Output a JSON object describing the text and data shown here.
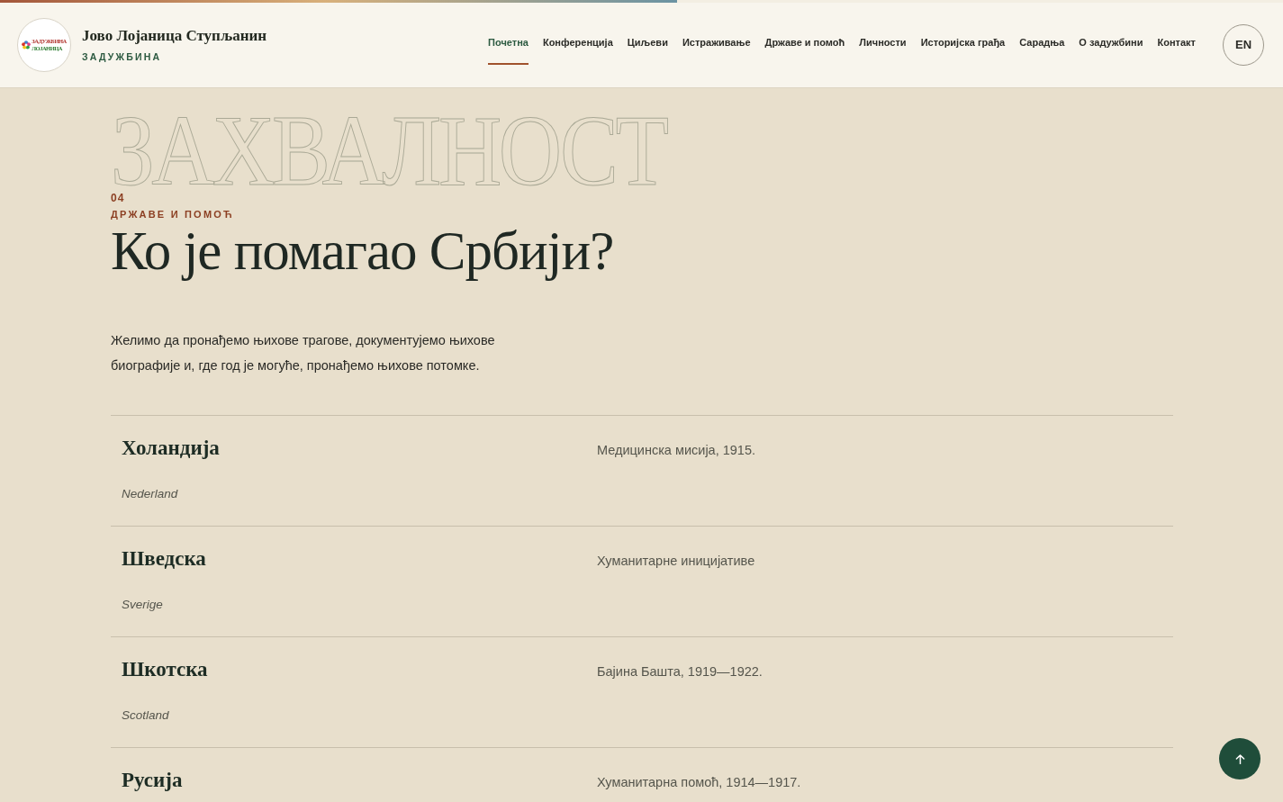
{
  "progress": {
    "level": 0.528
  },
  "header": {
    "logo": {
      "line_1": "ЗАДУЖБИНА",
      "line_2": "ЛОЈАНИЦА"
    },
    "title": "Јово Лојаница Ступљанин",
    "subtitle": "ЗАДУЖБИНА"
  },
  "nav": [
    {
      "label": "Почетна",
      "selected": true
    },
    {
      "label": "Конференција",
      "selected": false
    },
    {
      "label": "Циљеви",
      "selected": false
    },
    {
      "label": "Истраживање",
      "selected": false
    },
    {
      "label": "Државе и помоћ",
      "selected": false
    },
    {
      "label": "Личности",
      "selected": false
    },
    {
      "label": "Историјска грађа",
      "selected": false
    },
    {
      "label": "Сарадња",
      "selected": false
    },
    {
      "label": "О задужбини",
      "selected": false
    },
    {
      "label": "Контакт",
      "selected": false
    }
  ],
  "language_button": "EN",
  "hero": {
    "background_word": "ЗАХВАЛНОСТ",
    "number": "04",
    "eyebrow": "ДРЖАВЕ И ПОМОЋ",
    "heading": "Ко је помагао Србији?",
    "intro": "Желимо да пронађемо њихове трагове, документујемо њихове биографије и, где год је могуће, пронађемо њихове потомке."
  },
  "countries": [
    {
      "name": "Холандија",
      "native_name": "Nederland",
      "description": "Медицинска мисија, 1915."
    },
    {
      "name": "Шведска",
      "native_name": "Sverige",
      "description": "Хуманитарне иницијативе"
    },
    {
      "name": "Шкотска",
      "native_name": "Scotland",
      "description": "Бајина Башта, 1919—1922."
    },
    {
      "name": "Русија",
      "description": "Хуманитарна помоћ, 1914—1917."
    }
  ]
}
